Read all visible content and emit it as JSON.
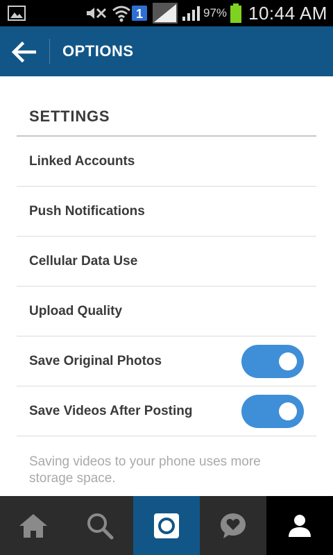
{
  "status_bar": {
    "icons": [
      "gallery-icon",
      "mute-icon",
      "wifi-icon",
      "sim-icon",
      "signal-icon",
      "signal-icon",
      "battery-icon"
    ],
    "sim_number": "1",
    "battery_percent": "97%",
    "time": "10:44 AM"
  },
  "app_bar": {
    "back_icon": "back-arrow-icon",
    "title": "OPTIONS",
    "background": "#125688"
  },
  "settings": {
    "header": "SETTINGS",
    "items": [
      {
        "label": "Linked Accounts"
      },
      {
        "label": "Push Notifications"
      },
      {
        "label": "Cellular Data Use"
      },
      {
        "label": "Upload Quality"
      },
      {
        "label": "Save Original Photos",
        "toggle": true
      },
      {
        "label": "Save Videos After Posting",
        "toggle": true
      }
    ],
    "note": "Saving videos to your phone uses more storage space.",
    "toggle_color": "#3f8ed8"
  },
  "bottom_nav": {
    "items": [
      "home-icon",
      "search-icon",
      "camera-icon",
      "activity-icon",
      "profile-icon"
    ],
    "active": "profile-icon"
  }
}
